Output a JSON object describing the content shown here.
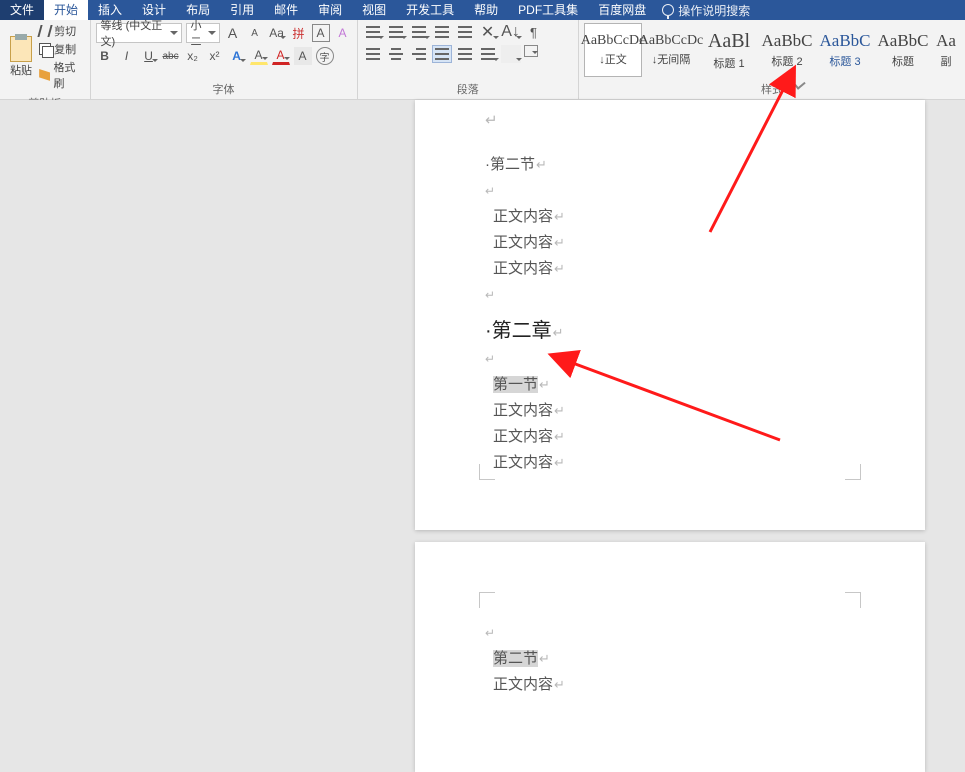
{
  "tabs": {
    "file": "文件",
    "home": "开始",
    "insert": "插入",
    "design": "设计",
    "layout": "布局",
    "references": "引用",
    "mailings": "邮件",
    "review": "审阅",
    "view": "视图",
    "devtools": "开发工具",
    "help": "帮助",
    "pdf": "PDF工具集",
    "baidu": "百度网盘",
    "search_hint": "操作说明搜索"
  },
  "clipboard": {
    "group_title": "剪贴板",
    "paste": "粘贴",
    "cut": "剪切",
    "copy": "复制",
    "format_painter": "格式刷"
  },
  "font": {
    "group_title": "字体",
    "name": "等线 (中文正文)",
    "size": "小二",
    "bold": "B",
    "italic": "I",
    "underline": "U",
    "strike": "abc",
    "sub": "x₂",
    "sup": "x²",
    "grow": "A",
    "shrink": "A",
    "clear": "A",
    "case": "Aa",
    "phonetic": "拼",
    "char_border": "A",
    "highlight": "A",
    "font_color": "A",
    "char_shading": "A",
    "enclose": "字"
  },
  "para": {
    "group_title": "段落"
  },
  "styles": {
    "group_title": "样式",
    "items": [
      {
        "preview": "AaBbCcDc",
        "label": "↓正文",
        "big": false,
        "blue": false,
        "sel": true
      },
      {
        "preview": "AaBbCcDc",
        "label": "↓无间隔",
        "big": false,
        "blue": false,
        "sel": false
      },
      {
        "preview": "AaBl",
        "label": "标题 1",
        "big": true,
        "blue": false,
        "sel": false
      },
      {
        "preview": "AaBbC",
        "label": "标题 2",
        "big": false,
        "blue": false,
        "sel": false
      },
      {
        "preview": "AaBbC",
        "label": "标题 3",
        "big": false,
        "blue": true,
        "sel": false
      },
      {
        "preview": "AaBbC",
        "label": "标题",
        "big": false,
        "blue": false,
        "sel": false
      },
      {
        "preview": "Aa",
        "label": "副",
        "big": false,
        "blue": false,
        "sel": false
      }
    ]
  },
  "doc": {
    "page1": {
      "sec2": "第二节",
      "body": "正文内容",
      "chap2": "第二章",
      "sec1": "第一节"
    },
    "page2": {
      "sec2": "第二节",
      "body": "正文内容"
    }
  }
}
